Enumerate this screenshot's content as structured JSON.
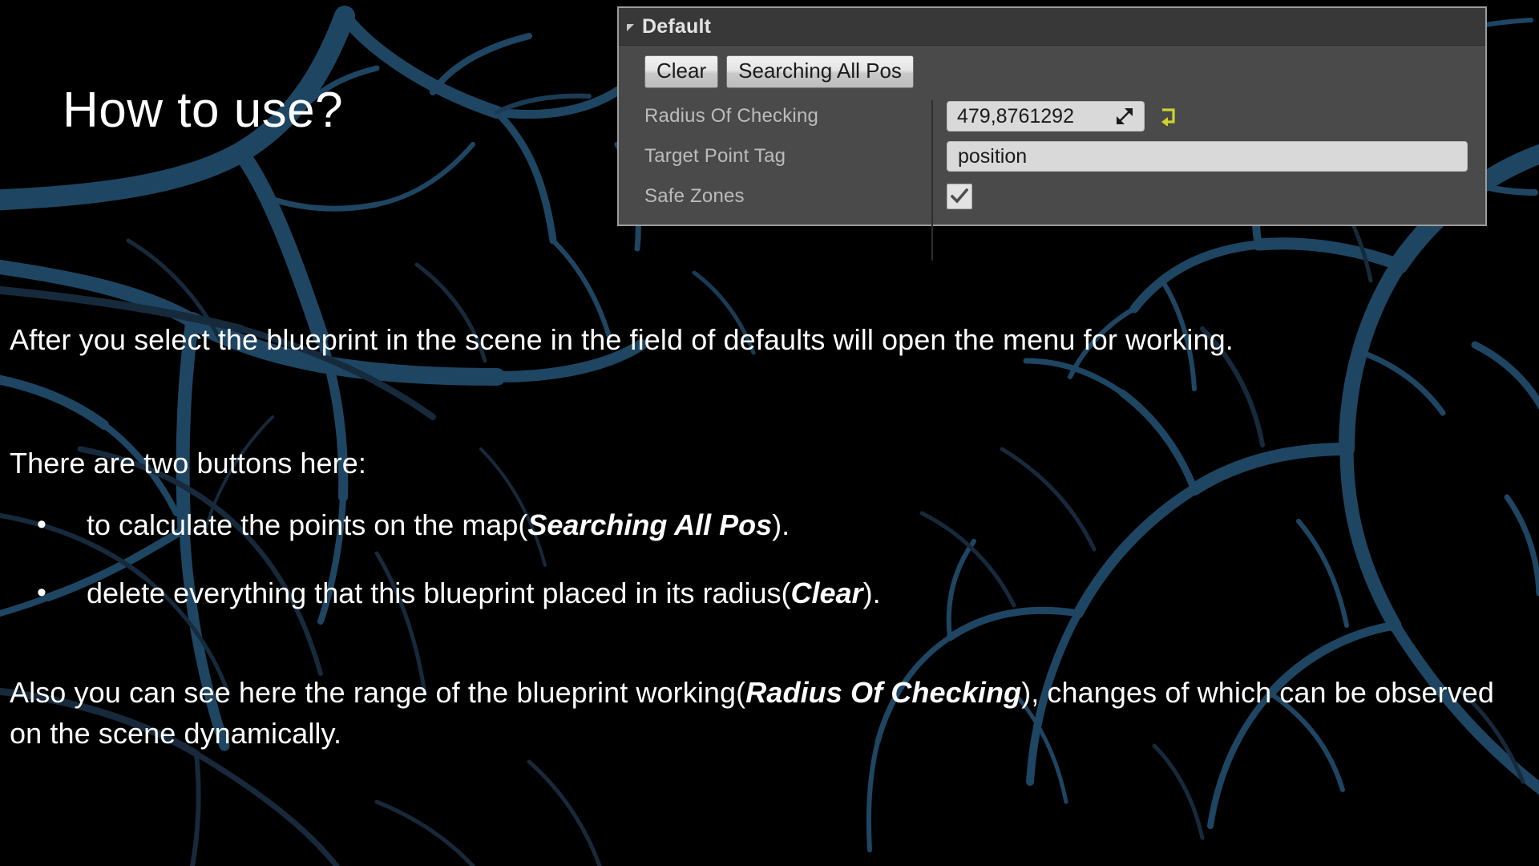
{
  "slide": {
    "title": "How to use?",
    "paragraph1": "After you select the blueprint in the scene in the field of defaults will open the menu for working.",
    "paragraph2": "There are two buttons here:",
    "bullets": [
      {
        "text_before": "to calculate the points on the map(",
        "emphasis": "Searching All Pos",
        "text_after": ")."
      },
      {
        "text_before": "delete everything that this blueprint placed in its radius(",
        "emphasis": "Clear",
        "text_after": ")."
      }
    ],
    "paragraph3": {
      "text_before": "Also  you can see here the range of the blueprint working(",
      "emphasis": "Radius Of Checking",
      "text_after": "), changes of which can be observed on the scene dynamically."
    },
    "bullet_glyph": "•"
  },
  "details_panel": {
    "header": {
      "title": "Default",
      "collapse_icon": "triangle-expanded-icon"
    },
    "buttons": [
      {
        "label": "Clear",
        "name": "clear-button"
      },
      {
        "label": "Searching All Pos",
        "name": "searching-all-pos-button"
      }
    ],
    "properties": [
      {
        "label": "Radius Of Checking",
        "type": "number",
        "value": "479,8761292",
        "spinner_icon": "drag-spinner-icon",
        "reset_icon": "reset-arrow-icon"
      },
      {
        "label": "Target Point Tag",
        "type": "text",
        "value": "position"
      },
      {
        "label": "Safe Zones",
        "type": "checkbox",
        "value": "checked",
        "check_icon": "checkmark-icon"
      }
    ]
  },
  "colors": {
    "slide_background": "#000000",
    "vein_color": "#1e4663",
    "vein_color_dark": "#132433",
    "panel_border": "#9c9c9c",
    "panel_header_bg": "#383838",
    "panel_body_bg": "#4a4a4a",
    "panel_label_text": "#bcbcbc",
    "field_bg": "#d9d9d9",
    "reset_arrow_color": "#d4d400",
    "text_color": "#ffffff"
  }
}
